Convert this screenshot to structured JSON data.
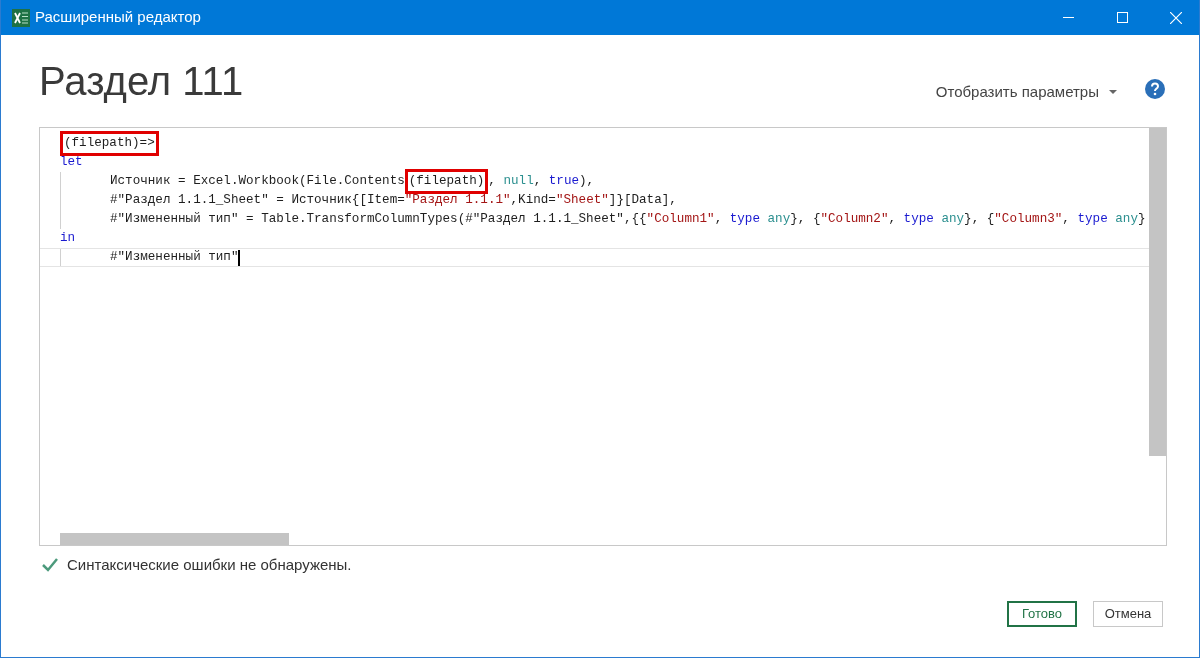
{
  "window": {
    "title": "Расширенный редактор"
  },
  "heading": "Раздел 111",
  "options_menu": {
    "label": "Отобразить параметры"
  },
  "editor": {
    "lines": [
      {
        "current": false,
        "tokens": [
          {
            "text": "(filepath)=>",
            "kind": "plain",
            "boxed": true
          }
        ]
      },
      {
        "current": false,
        "tokens": [
          {
            "text": "let",
            "kind": "keyword",
            "boxed": false
          }
        ],
        "children": [
          {
            "current": false,
            "tokens": [
              {
                "text": "Источник = Excel.Workbook(File.Contents",
                "kind": "plain",
                "boxed": false
              },
              {
                "text": "(filepath)",
                "kind": "plain",
                "boxed": true
              },
              {
                "text": ", ",
                "kind": "plain",
                "boxed": false
              },
              {
                "text": "null",
                "kind": "constant",
                "boxed": false
              },
              {
                "text": ", ",
                "kind": "plain",
                "boxed": false
              },
              {
                "text": "true",
                "kind": "keyword",
                "boxed": false
              },
              {
                "text": "),",
                "kind": "plain",
                "boxed": false
              }
            ]
          },
          {
            "current": false,
            "tokens": [
              {
                "text": "#\"Раздел 1.1.1_Sheet\" = Источник{[Item=",
                "kind": "plain",
                "boxed": false
              },
              {
                "text": "\"Раздел 1.1.1\"",
                "kind": "string",
                "boxed": false
              },
              {
                "text": ",Kind=",
                "kind": "plain",
                "boxed": false
              },
              {
                "text": "\"Sheet\"",
                "kind": "string",
                "boxed": false
              },
              {
                "text": "]}[Data],",
                "kind": "plain",
                "boxed": false
              }
            ]
          },
          {
            "current": false,
            "tokens": [
              {
                "text": "#\"Измененный тип\" = Table.TransformColumnTypes(#\"Раздел 1.1.1_Sheet\",{{",
                "kind": "plain",
                "boxed": false
              },
              {
                "text": "\"Column1\"",
                "kind": "string",
                "boxed": false
              },
              {
                "text": ", ",
                "kind": "plain",
                "boxed": false
              },
              {
                "text": "type",
                "kind": "keyword",
                "boxed": false
              },
              {
                "text": " any",
                "kind": "constant",
                "boxed": false
              },
              {
                "text": "}, {",
                "kind": "plain",
                "boxed": false
              },
              {
                "text": "\"Column2\"",
                "kind": "string",
                "boxed": false
              },
              {
                "text": ", ",
                "kind": "plain",
                "boxed": false
              },
              {
                "text": "type",
                "kind": "keyword",
                "boxed": false
              },
              {
                "text": " any",
                "kind": "constant",
                "boxed": false
              },
              {
                "text": "}, {",
                "kind": "plain",
                "boxed": false
              },
              {
                "text": "\"Column3\"",
                "kind": "string",
                "boxed": false
              },
              {
                "text": ", ",
                "kind": "plain",
                "boxed": false
              },
              {
                "text": "type",
                "kind": "keyword",
                "boxed": false
              },
              {
                "text": " any",
                "kind": "constant",
                "boxed": false
              },
              {
                "text": "}",
                "kind": "plain",
                "boxed": false
              }
            ]
          }
        ]
      },
      {
        "current": false,
        "tokens": [
          {
            "text": "in",
            "kind": "keyword",
            "boxed": false
          }
        ],
        "children": [
          {
            "current": true,
            "tokens": [
              {
                "text": "#\"Измененный тип\"",
                "kind": "plain",
                "boxed": false
              }
            ]
          }
        ]
      }
    ]
  },
  "status": {
    "ok": true,
    "text": "Синтаксические ошибки не обнаружены."
  },
  "buttons": [
    {
      "label": "Готово",
      "primary": true
    },
    {
      "label": "Отмена",
      "primary": false
    }
  ]
}
